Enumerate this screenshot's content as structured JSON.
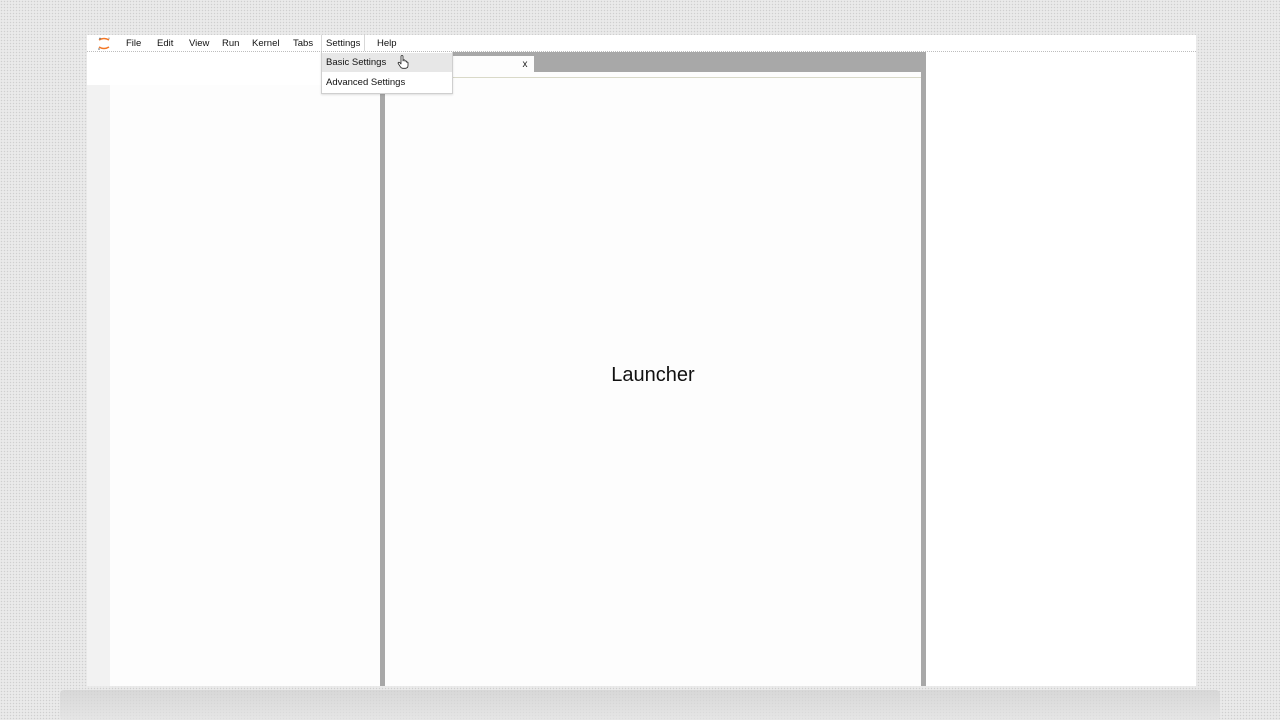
{
  "menubar": {
    "logo_icon": "jupyter-logo-icon",
    "items": [
      {
        "label": "File"
      },
      {
        "label": "Edit"
      },
      {
        "label": "View"
      },
      {
        "label": "Run"
      },
      {
        "label": "Kernel"
      },
      {
        "label": "Tabs"
      },
      {
        "label": "Settings",
        "active": true
      },
      {
        "label": "Help"
      }
    ]
  },
  "settings_menu": {
    "items": [
      {
        "label": "Basic Settings",
        "hovered": true
      },
      {
        "label": "Advanced Settings"
      }
    ]
  },
  "main": {
    "tab": {
      "close_label": "x"
    },
    "launcher_title": "Launcher"
  },
  "colors": {
    "logo_accent": "#f37726",
    "splitter": "#a8a8a8"
  },
  "cursor": "hand-pointer-icon"
}
